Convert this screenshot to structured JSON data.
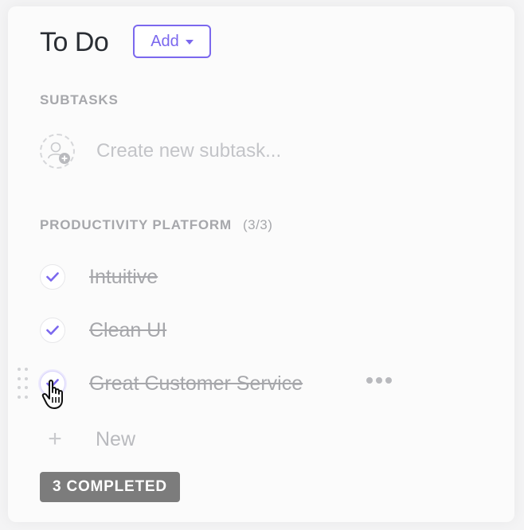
{
  "header": {
    "title": "To Do",
    "add_label": "Add",
    "accent_color": "#7b68ee"
  },
  "subtasks": {
    "label": "SUBTASKS",
    "create_placeholder": "Create new subtask..."
  },
  "checklist": {
    "label": "PRODUCTIVITY PLATFORM",
    "count": "(3/3)",
    "items": [
      {
        "label": "Intuitive",
        "checked": true
      },
      {
        "label": "Clean UI",
        "checked": true
      },
      {
        "label": "Great Customer Service",
        "checked": true
      }
    ],
    "new_label": "New",
    "completed_badge": "3 COMPLETED"
  },
  "icons": {
    "add_caret": "caret-down-icon",
    "assignee": "add-assignee-icon",
    "check": "checkmark-icon",
    "drag": "drag-handle-icon",
    "more": "more-dots-icon",
    "plus": "plus-icon",
    "cursor": "pointer-hand-icon"
  }
}
